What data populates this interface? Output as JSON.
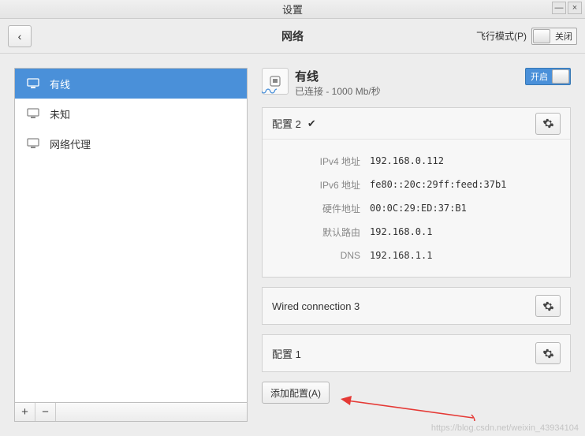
{
  "window": {
    "title": "设置"
  },
  "toolbar": {
    "title": "网络",
    "back_icon": "‹",
    "airplane_label": "飞行模式(P)",
    "airplane_off": "关闭"
  },
  "sidebar": {
    "items": [
      {
        "label": "有线"
      },
      {
        "label": "未知"
      },
      {
        "label": "网络代理"
      }
    ],
    "add": "+",
    "remove": "−"
  },
  "main": {
    "title": "有线",
    "status": "已连接 - 1000 Mb/秒",
    "on_label": "开启",
    "profile2": {
      "name": "配置 2",
      "rows": [
        {
          "k": "IPv4 地址",
          "v": "192.168.0.112"
        },
        {
          "k": "IPv6 地址",
          "v": "fe80::20c:29ff:feed:37b1"
        },
        {
          "k": "硬件地址",
          "v": "00:0C:29:ED:37:B1"
        },
        {
          "k": "默认路由",
          "v": "192.168.0.1"
        },
        {
          "k": "DNS",
          "v": "192.168.1.1"
        }
      ]
    },
    "wired3": "Wired connection 3",
    "profile1": "配置 1",
    "add_profile": "添加配置(A)"
  },
  "watermark": "https://blog.csdn.net/weixin_43934104"
}
